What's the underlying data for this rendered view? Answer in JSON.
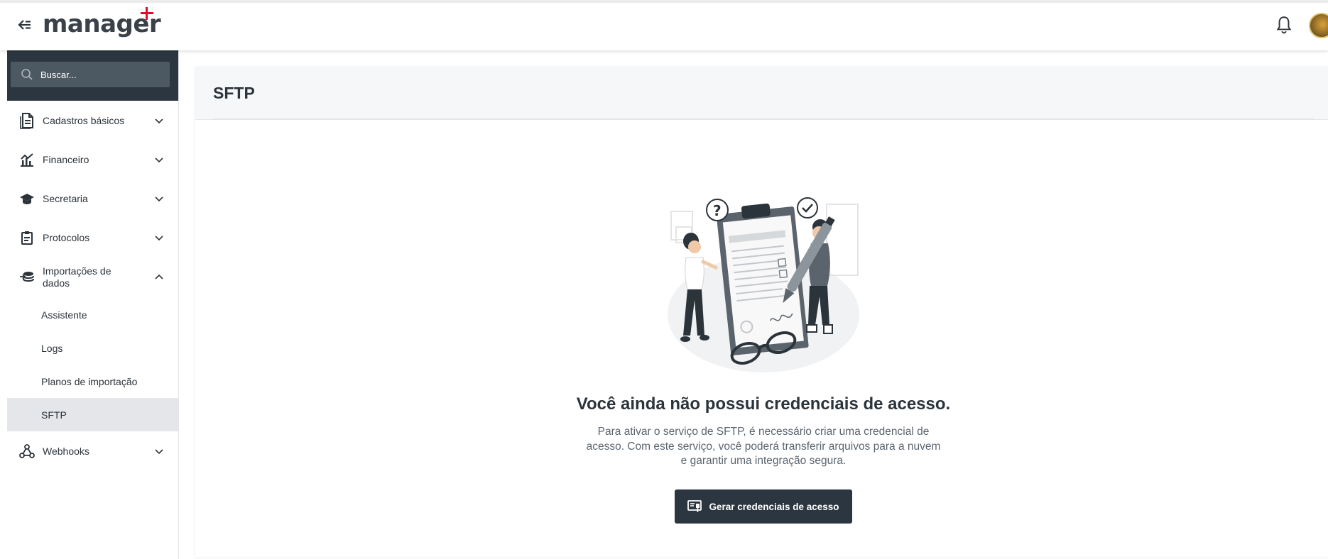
{
  "app": {
    "logo_text": "manager",
    "brand_color": "#e30b2a",
    "dark_color": "#2b3640"
  },
  "header": {
    "back_icon": "arrow-left-icon",
    "notifications_icon": "bell-icon"
  },
  "sidebar": {
    "search": {
      "placeholder": "Buscar..."
    },
    "items": [
      {
        "label": "Cadastros básicos",
        "icon": "document-icon",
        "expanded": false
      },
      {
        "label": "Financeiro",
        "icon": "chart-icon",
        "expanded": false
      },
      {
        "label": "Secretaria",
        "icon": "graduation-cap-icon",
        "expanded": false
      },
      {
        "label": "Protocolos",
        "icon": "clipboard-icon",
        "expanded": false
      },
      {
        "label": "Importações de dados",
        "icon": "database-import-icon",
        "expanded": true,
        "children": [
          {
            "label": "Assistente"
          },
          {
            "label": "Logs"
          },
          {
            "label": "Planos de importação"
          },
          {
            "label": "SFTP",
            "active": true
          }
        ]
      },
      {
        "label": "Webhooks",
        "icon": "webhook-icon",
        "expanded": false
      }
    ]
  },
  "main": {
    "page_title": "SFTP",
    "empty_state": {
      "title": "Você ainda não possui credenciais de acesso.",
      "description": "Para ativar o serviço de SFTP, é necessário criar uma credencial de acesso. Com este serviço, você poderá transferir arquivos para a nuvem e garantir uma integração segura.",
      "button_label": "Gerar credenciais de acesso"
    }
  }
}
